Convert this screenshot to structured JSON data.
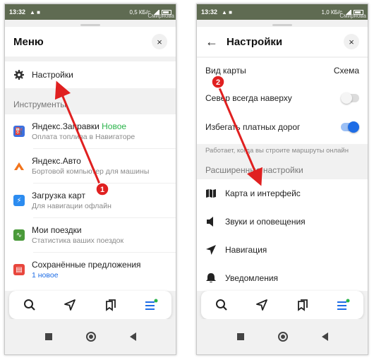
{
  "colors": {
    "accent": "#1e6de6",
    "green_badge": "#2ab34a",
    "arrow": "#e02020"
  },
  "status_left": {
    "time": "13:32",
    "net": "0,5 КБ/с",
    "map_text": "Смирнова"
  },
  "status_right": {
    "time": "13:32",
    "net": "1,0 КБ/с",
    "map_text": "Смирнова"
  },
  "menu": {
    "title": "Меню",
    "close_icon": "×",
    "settings_label": "Настройки",
    "section_label": "Инструменты",
    "items": [
      {
        "title": "Яндекс.Заправки",
        "badge": "Новое",
        "subtitle": "Оплата топлива в Навигаторе",
        "icon": "fuel-icon",
        "color": "#3b6fe0"
      },
      {
        "title": "Яндекс.Авто",
        "subtitle": "Бортовой компьютер для машины",
        "icon": "auto-icon",
        "color": "#f2741c"
      },
      {
        "title": "Загрузка карт",
        "subtitle": "Для навигации офлайн",
        "icon": "download-icon",
        "color": "#2c8cf0"
      },
      {
        "title": "Мои поездки",
        "subtitle": "Статистика ваших поездок",
        "icon": "trips-icon",
        "color": "#4a9a3a"
      },
      {
        "title": "Сохранённые предложения",
        "subtitle": "1 новое",
        "icon": "saved-icon",
        "color": "#e8463d"
      }
    ]
  },
  "settings": {
    "title": "Настройки",
    "map_view_label": "Вид карты",
    "map_view_value": "Схема",
    "north_label": "Север всегда наверху",
    "north_enabled": false,
    "tolls_label": "Избегать платных дорог",
    "tolls_enabled": true,
    "note": "Работает, когда вы строите маршруты онлайн",
    "advanced_label": "Расширенные настройки",
    "items": [
      {
        "label": "Карта и интерфейс",
        "icon": "map-icon"
      },
      {
        "label": "Звуки и оповещения",
        "icon": "sound-icon"
      },
      {
        "label": "Навигация",
        "icon": "navigation-icon"
      },
      {
        "label": "Уведомления",
        "icon": "bell-icon"
      }
    ]
  },
  "annotations": {
    "step1": "1",
    "step2": "2"
  }
}
